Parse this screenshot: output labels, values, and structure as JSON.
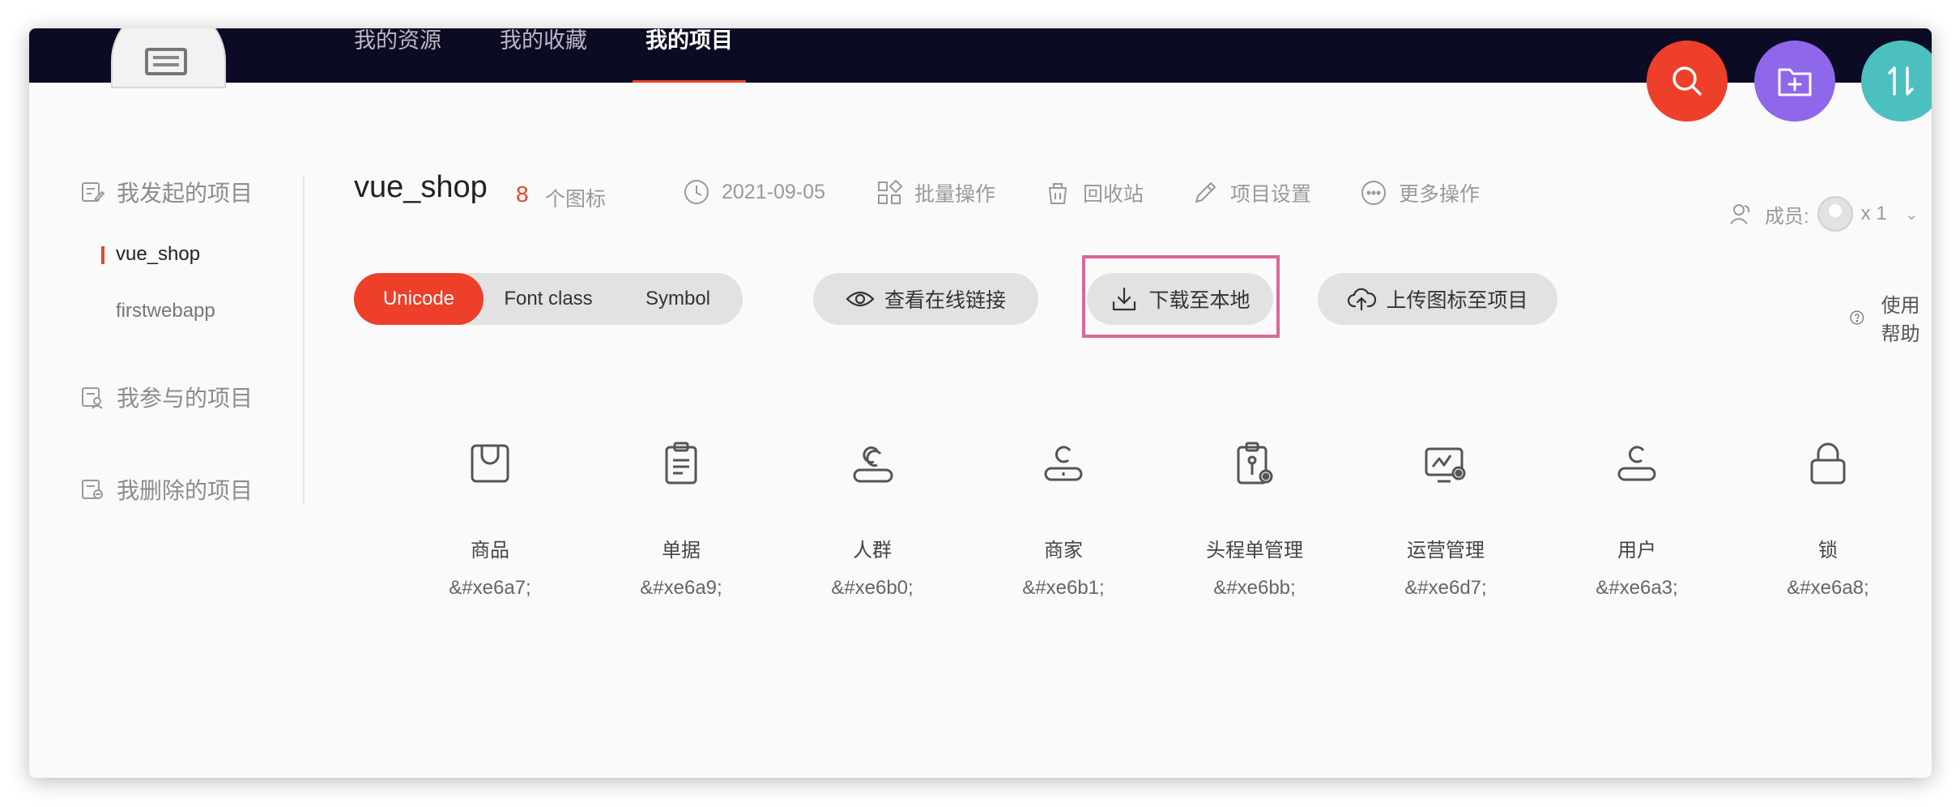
{
  "topnav": {
    "items": [
      {
        "label": "我的资源"
      },
      {
        "label": "我的收藏"
      },
      {
        "label": "我的项目",
        "active": true
      }
    ]
  },
  "fabs": {
    "search_icon": "search-icon",
    "add_folder_icon": "add-folder-icon",
    "sort_icon": "sort-icon"
  },
  "sidebar": {
    "initiated_label": "我发起的项目",
    "projects": [
      {
        "label": "vue_shop",
        "active": true
      },
      {
        "label": "firstwebapp"
      }
    ],
    "participated_label": "我参与的项目",
    "deleted_label": "我删除的项目"
  },
  "project": {
    "title": "vue_shop",
    "count": "8",
    "count_label": "个图标",
    "date": "2021-09-05",
    "batch_label": "批量操作",
    "recycle_label": "回收站",
    "settings_label": "项目设置",
    "more_label": "更多操作",
    "members_label": "成员:",
    "members_count": "x 1"
  },
  "toolbar": {
    "tabs": [
      {
        "label": "Unicode",
        "active": true
      },
      {
        "label": "Font class"
      },
      {
        "label": "Symbol"
      }
    ],
    "view_link_label": "查看在线链接",
    "download_label": "下载至本地",
    "upload_label": "上传图标至项目",
    "help_label": "使用帮助"
  },
  "icons": [
    {
      "name": "商品",
      "code": "&#xe6a7;",
      "icon": "shopping-bag-icon"
    },
    {
      "name": "单据",
      "code": "&#xe6a9;",
      "icon": "clipboard-icon"
    },
    {
      "name": "人群",
      "code": "&#xe6b0;",
      "icon": "people-icon"
    },
    {
      "name": "商家",
      "code": "&#xe6b1;",
      "icon": "merchant-icon"
    },
    {
      "name": "头程单管理",
      "code": "&#xe6bb;",
      "icon": "order-manage-icon"
    },
    {
      "name": "运营管理",
      "code": "&#xe6d7;",
      "icon": "operations-icon"
    },
    {
      "name": "用户",
      "code": "&#xe6a3;",
      "icon": "user-icon"
    },
    {
      "name": "锁",
      "code": "&#xe6a8;",
      "icon": "lock-icon"
    }
  ],
  "colors": {
    "accent": "#ee3f2a",
    "topbar": "#0b0b23",
    "purple": "#8e67ea",
    "teal": "#4cc0c0",
    "highlight": "#d9689a"
  }
}
